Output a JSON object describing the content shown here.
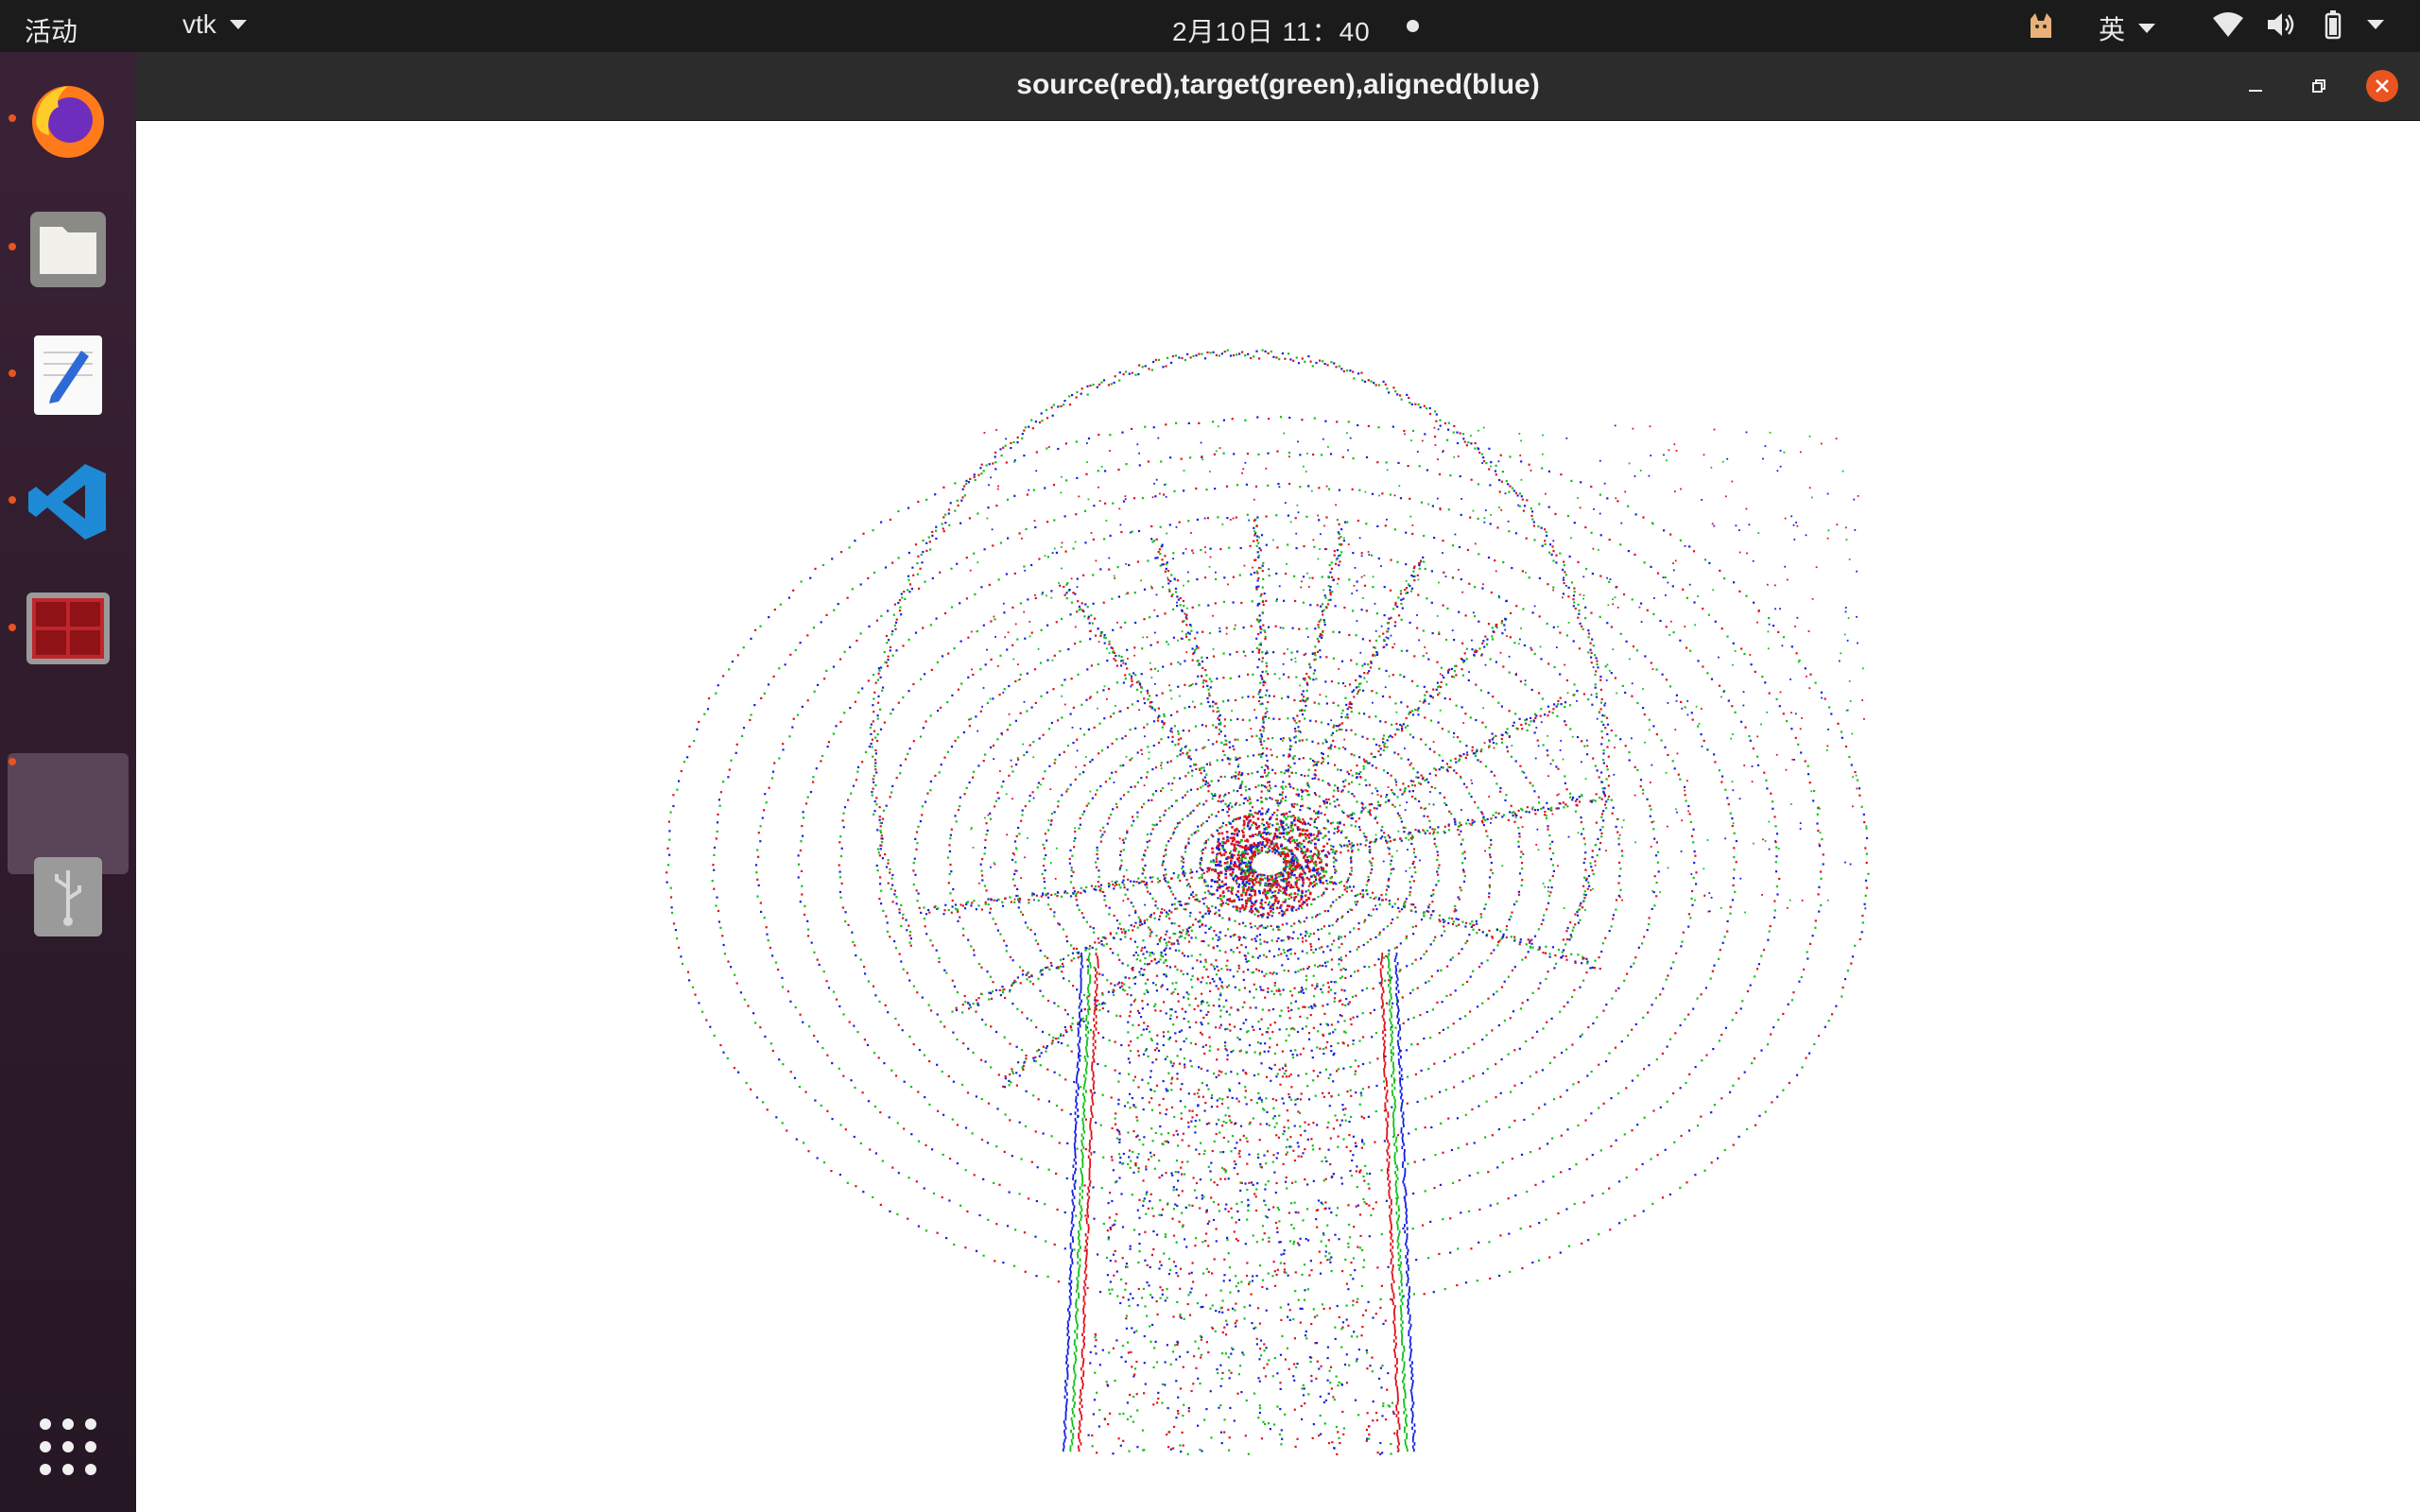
{
  "topbar": {
    "activities": "活动",
    "app_menu": "vtk",
    "clock": "2月10日  11：40",
    "ime": "英"
  },
  "window": {
    "title": "source(red),target(green),aligned(blue)"
  },
  "dock": {
    "items": [
      "firefox-icon",
      "files-icon",
      "text-editor-icon",
      "vscode-icon",
      "terminal-icon",
      "vtk-window-icon",
      "usb-drive-icon"
    ],
    "app_grid": "show-applications-icon"
  },
  "colors": {
    "source": "#e0101a",
    "target": "#12c01a",
    "aligned": "#1420e0",
    "accent": "#e95420"
  },
  "point_cloud": {
    "series": [
      "source",
      "target",
      "aligned"
    ]
  }
}
